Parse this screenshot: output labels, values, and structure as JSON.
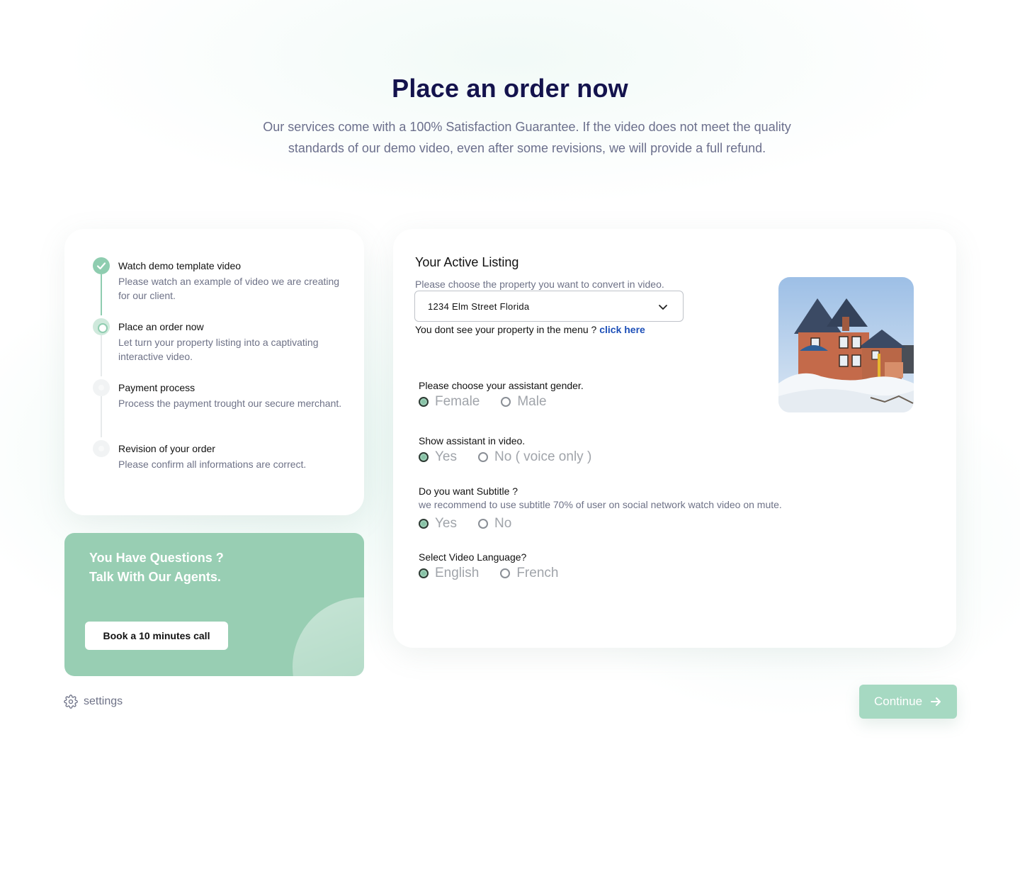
{
  "hero": {
    "title": "Place an order now",
    "subtitle": "Our services come with a 100% Satisfaction Guarantee. If the video does not meet the quality standards of our demo video, even after some revisions, we will provide a full refund."
  },
  "steps": [
    {
      "title": "Watch demo template video",
      "desc": "Please watch an example of video we are creating for our client.",
      "state": "done"
    },
    {
      "title": "Place an order now",
      "desc": "Let turn your property listing into a captivating interactive video.",
      "state": "current"
    },
    {
      "title": "Payment process",
      "desc": "Process the payment trought our secure merchant.",
      "state": "todo"
    },
    {
      "title": "Revision of your order",
      "desc": "Please confirm all informations are correct.",
      "state": "todo"
    }
  ],
  "help": {
    "line1": "You Have Questions ?",
    "line2": "Talk With Our Agents.",
    "button": "Book a 10 minutes call"
  },
  "settings": {
    "label": "settings",
    "icon": "gear-icon"
  },
  "listing": {
    "title": "Your Active Listing",
    "hint": "Please choose the property you want to convert in video.",
    "selected": "1234 Elm Street Florida",
    "missing_text": "You dont see your property in the menu ?",
    "missing_link": "click here"
  },
  "questions": {
    "gender": {
      "label": "Please choose your assistant gender.",
      "options": [
        "Female",
        "Male"
      ],
      "selected": "Female"
    },
    "show": {
      "label": "Show assistant in video.",
      "options": [
        "Yes",
        "No ( voice only )"
      ],
      "selected": "Yes"
    },
    "subtitle": {
      "label": "Do you want Subtitle ?",
      "note": "we recommend to use subtitle 70% of user on social network watch video on mute.",
      "options": [
        "Yes",
        "No"
      ],
      "selected": "Yes"
    },
    "language": {
      "label": "Select Video Language?",
      "options": [
        "English",
        "French"
      ],
      "selected": "English"
    }
  },
  "continue": {
    "label": "Continue",
    "icon": "arrow-right-icon"
  },
  "colors": {
    "accent": "#98ceb3",
    "title": "#14134d",
    "link": "#1d4fb8"
  }
}
